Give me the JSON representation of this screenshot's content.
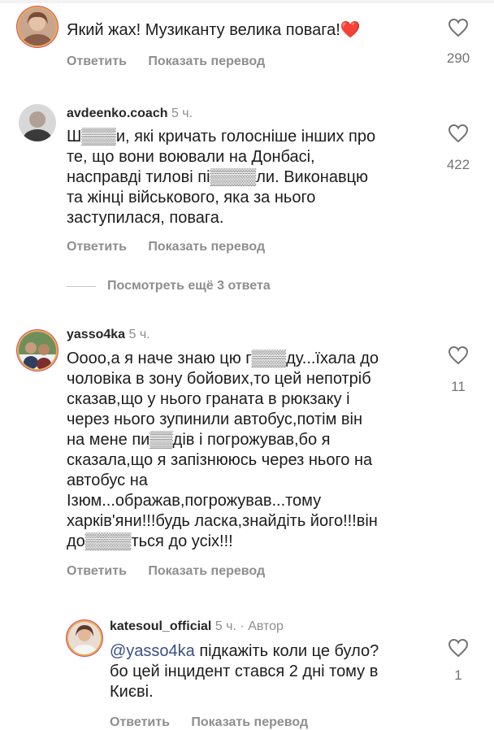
{
  "comments": [
    {
      "text_lines": [
        "Який жах! Музиканту велика повага!❤️"
      ],
      "reply": "Ответить",
      "translate": "Показать перевод",
      "likes": "290"
    },
    {
      "username": "avdeenko.coach",
      "time": "5 ч.",
      "text_lines": [
        "Ш▒▒▒и, які кричать голосніше інших про",
        "те, що вони воювали на Донбасі,",
        "насправді тилові пі▒▒▒▒ли. Виконавцю",
        "та жінці військового, яка за нього",
        "заступилася, повага."
      ],
      "reply": "Ответить",
      "translate": "Показать перевод",
      "likes": "422",
      "view_more": "Посмотреть ещё 3 ответа"
    },
    {
      "username": "yasso4ka",
      "time": "5 ч.",
      "text_lines": [
        "Оооо,а я наче знаю цю г▒▒▒ду...їхала до",
        "чоловіка в зону бойових,то цей непотріб",
        "сказав,що у нього граната в рюкзаку і",
        "через нього зупинили автобус,потім він",
        "на мене пи▒▒дів і погрожував,бо я",
        "сказала,що я запізнююсь через нього на",
        "автобус на",
        "Ізюм...ображав,погрожував...тому",
        "харків'яни!!!будь ласка,знайдіть його!!!він",
        "до▒▒▒▒ться до усіх!!!"
      ],
      "reply": "Ответить",
      "translate": "Показать перевод",
      "likes": "11"
    },
    {
      "username": "katesoul_official",
      "time": "5 ч.",
      "author_badge": "Автор",
      "mention": "@yasso4ka",
      "text_first_rest": " підкажіть коли це було?",
      "text_lines": [
        "бо цей інцидент стався 2 дні тому в",
        "Києві."
      ],
      "reply": "Ответить",
      "translate": "Показать перевод",
      "likes": "1"
    }
  ]
}
